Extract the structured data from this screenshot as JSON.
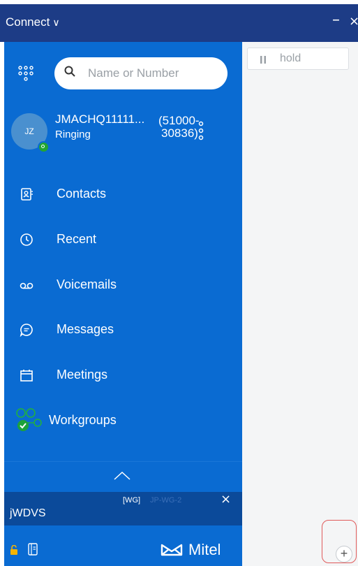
{
  "titlebar": {
    "title": "Connect",
    "minimize": "–",
    "close": "×"
  },
  "search": {
    "placeholder": "Name or Number"
  },
  "active_call": {
    "avatar_initials": "JZ",
    "name": "JMACHQ11111...",
    "status": "Ringing",
    "number_line1": "(51000-",
    "number_line2": "30836)"
  },
  "nav": [
    {
      "label": "Contacts",
      "icon": "contacts-icon"
    },
    {
      "label": "Recent",
      "icon": "clock-icon"
    },
    {
      "label": "Voicemails",
      "icon": "voicemail-icon"
    },
    {
      "label": "Messages",
      "icon": "chat-icon"
    },
    {
      "label": "Meetings",
      "icon": "calendar-icon"
    },
    {
      "label": "Workgroups",
      "icon": "workgroups-icon"
    }
  ],
  "banner": {
    "tag": "[WG]",
    "tag_detail": "JP-WG-2",
    "close": "×",
    "name": "jWDVS"
  },
  "footer": {
    "brand": "Mitel"
  },
  "right_pane": {
    "hold_label": "hold",
    "add_label": "+"
  },
  "colors": {
    "sidebar": "#0a6bd2",
    "titlebar": "#1d3c86",
    "banner": "#0b4a9a",
    "presence": "#22a533"
  }
}
